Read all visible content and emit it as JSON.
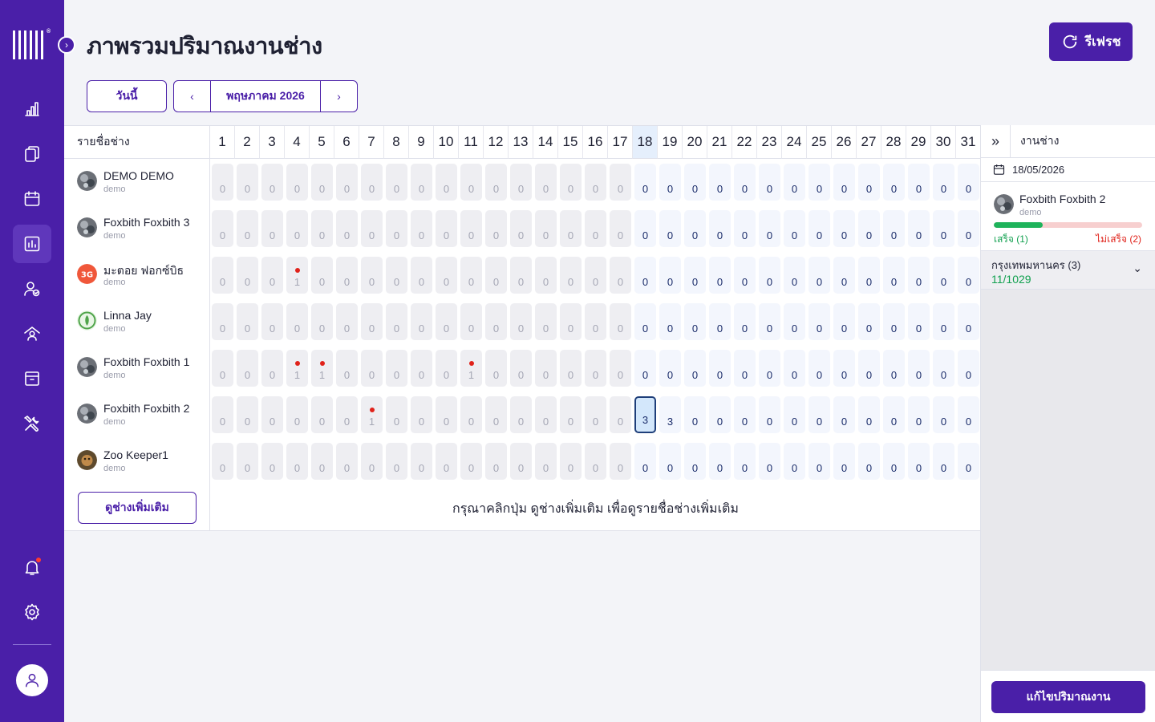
{
  "header": {
    "title": "ภาพรวมปริมาณงานช่าง",
    "refresh_label": "รีเฟรช",
    "today_label": "วันนี้",
    "month_label": "พฤษภาคม 2026",
    "prev_icon": "chevron-left-icon",
    "next_icon": "chevron-right-icon"
  },
  "sidebar": {
    "items": [
      {
        "name": "bar-chart-icon"
      },
      {
        "name": "documents-icon"
      },
      {
        "name": "calendar-icon"
      },
      {
        "name": "report-icon",
        "active": true
      },
      {
        "name": "user-check-icon"
      },
      {
        "name": "home-user-icon"
      },
      {
        "name": "archive-icon"
      },
      {
        "name": "tools-icon"
      }
    ],
    "bottom": [
      {
        "name": "bell-icon",
        "badge": true
      },
      {
        "name": "gear-icon"
      }
    ],
    "profile_icon": "user-icon"
  },
  "grid": {
    "name_header": "รายชื่อช่าง",
    "days": [
      "1",
      "2",
      "3",
      "4",
      "5",
      "6",
      "7",
      "8",
      "9",
      "10",
      "11",
      "12",
      "13",
      "14",
      "15",
      "16",
      "17",
      "18",
      "19",
      "20",
      "21",
      "22",
      "23",
      "24",
      "25",
      "26",
      "27",
      "28",
      "29",
      "30",
      "31"
    ],
    "today_index": 17,
    "selected": {
      "row": 5,
      "day": 17
    },
    "technicians": [
      {
        "name": "DEMO DEMO",
        "sub": "demo",
        "avatar": "photo",
        "counts": [
          0,
          0,
          0,
          0,
          0,
          0,
          0,
          0,
          0,
          0,
          0,
          0,
          0,
          0,
          0,
          0,
          0,
          0,
          0,
          0,
          0,
          0,
          0,
          0,
          0,
          0,
          0,
          0,
          0,
          0,
          0
        ],
        "flags": []
      },
      {
        "name": "Foxbith Foxbith 3",
        "sub": "demo",
        "avatar": "photo",
        "counts": [
          0,
          0,
          0,
          0,
          0,
          0,
          0,
          0,
          0,
          0,
          0,
          0,
          0,
          0,
          0,
          0,
          0,
          0,
          0,
          0,
          0,
          0,
          0,
          0,
          0,
          0,
          0,
          0,
          0,
          0,
          0
        ],
        "flags": []
      },
      {
        "name": "มะตอย ฟอกซ์บิธ",
        "sub": "demo",
        "avatar": "logo",
        "counts": [
          0,
          0,
          0,
          1,
          0,
          0,
          0,
          0,
          0,
          0,
          0,
          0,
          0,
          0,
          0,
          0,
          0,
          0,
          0,
          0,
          0,
          0,
          0,
          0,
          0,
          0,
          0,
          0,
          0,
          0,
          0
        ],
        "flags": [
          3
        ]
      },
      {
        "name": "Linna Jay",
        "sub": "demo",
        "avatar": "leaf",
        "counts": [
          0,
          0,
          0,
          0,
          0,
          0,
          0,
          0,
          0,
          0,
          0,
          0,
          0,
          0,
          0,
          0,
          0,
          0,
          0,
          0,
          0,
          0,
          0,
          0,
          0,
          0,
          0,
          0,
          0,
          0,
          0
        ],
        "flags": []
      },
      {
        "name": "Foxbith Foxbith 1",
        "sub": "demo",
        "avatar": "photo",
        "counts": [
          0,
          0,
          0,
          1,
          1,
          0,
          0,
          0,
          0,
          0,
          1,
          0,
          0,
          0,
          0,
          0,
          0,
          0,
          0,
          0,
          0,
          0,
          0,
          0,
          0,
          0,
          0,
          0,
          0,
          0,
          0
        ],
        "flags": [
          3,
          4,
          10
        ]
      },
      {
        "name": "Foxbith Foxbith 2",
        "sub": "demo",
        "avatar": "photo",
        "counts": [
          0,
          0,
          0,
          0,
          0,
          0,
          1,
          0,
          0,
          0,
          0,
          0,
          0,
          0,
          0,
          0,
          0,
          3,
          3,
          0,
          0,
          0,
          0,
          0,
          0,
          0,
          0,
          0,
          0,
          0,
          0
        ],
        "flags": [
          6
        ]
      },
      {
        "name": "Zoo Keeper1",
        "sub": "demo",
        "avatar": "animal",
        "counts": [
          0,
          0,
          0,
          0,
          0,
          0,
          0,
          0,
          0,
          0,
          0,
          0,
          0,
          0,
          0,
          0,
          0,
          0,
          0,
          0,
          0,
          0,
          0,
          0,
          0,
          0,
          0,
          0,
          0,
          0,
          0
        ],
        "flags": []
      }
    ],
    "more_label": "ดูช่างเพิ่มเติม",
    "hint": "กรุณาคลิกปุ่ม ดูช่างเพิ่มเติม เพื่อดูรายชื่อช่างเพิ่มเติม"
  },
  "panel": {
    "toggle_icon": "double-chevron-right-icon",
    "title": "งานช่าง",
    "date": "18/05/2026",
    "tech_name": "Foxbith Foxbith 2",
    "tech_sub": "demo",
    "progress_fraction": 0.33,
    "success_label": "เสร็จ (1)",
    "fail_label": "ไม่เสร็จ (2)",
    "zone_name": "กรุงเทพมหานคร (3)",
    "zone_count": "11/1029",
    "edit_label": "แก้ไขปริมาณงาน",
    "colors": {
      "accent": "#4a1fa8",
      "success": "#12a150",
      "fail": "#e0221a"
    }
  }
}
